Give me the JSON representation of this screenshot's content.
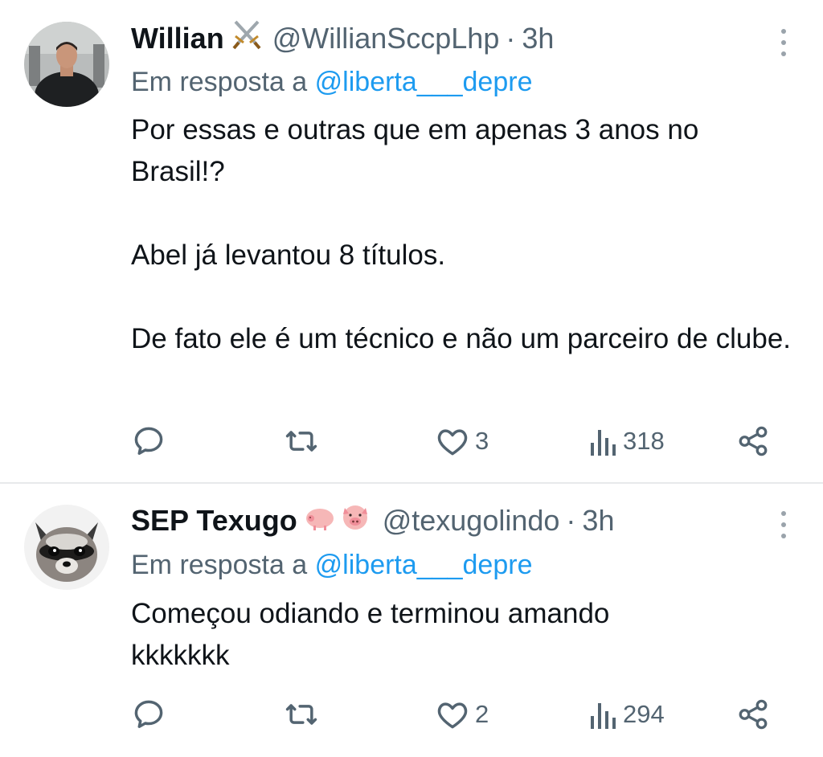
{
  "tweets": [
    {
      "display_name": "Willian",
      "name_emoji": "⚔️",
      "handle": "@WillianSccpLhp",
      "time": "3h",
      "reply_prefix": "Em resposta a",
      "reply_to": "@liberta___depre",
      "paragraphs": [
        "Por essas e outras que em apenas 3 anos no Brasil!?",
        "Abel já levantou 8 títulos.",
        "De fato ele é um técnico e não um parceiro de clube."
      ],
      "likes": "3",
      "views": "318",
      "avatar": "man-in-gym-photo"
    },
    {
      "display_name": "SEP Texugo",
      "name_emoji": "🐖🐷",
      "handle": "@texugolindo",
      "time": "3h",
      "reply_prefix": "Em resposta a",
      "reply_to": "@liberta___depre",
      "paragraphs": [
        "Começou odiando e terminou amando kkkkkkk"
      ],
      "likes": "2",
      "views": "294",
      "avatar": "raccoon-photo"
    }
  ],
  "icons": {
    "reply": "reply-icon",
    "retweet": "retweet-icon",
    "like": "heart-icon",
    "views": "views-icon",
    "share": "share-icon",
    "more": "more-icon"
  },
  "colors": {
    "text": "#0f1419",
    "secondary": "#536471",
    "link": "#1d9bf0",
    "divider": "#e7e9eb"
  }
}
